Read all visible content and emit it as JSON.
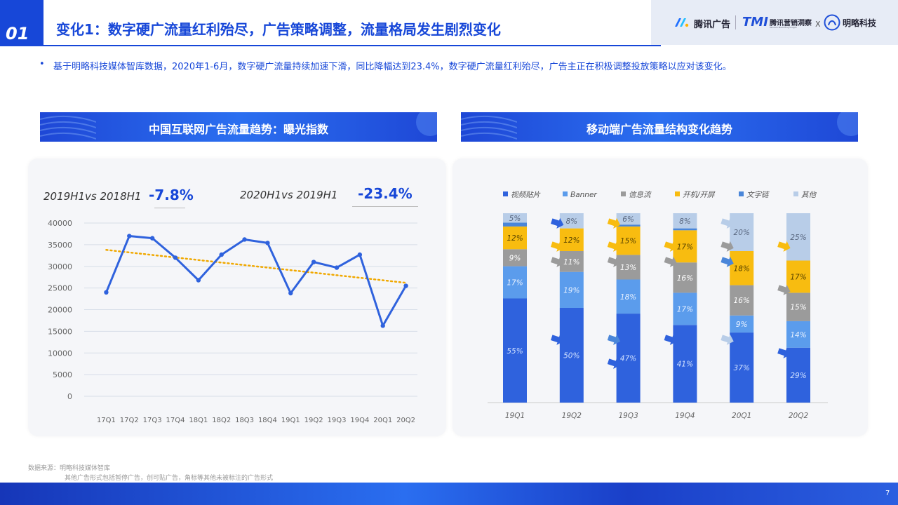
{
  "header": {
    "number": "01",
    "title": "变化1：数字硬广流量红利殆尽，广告策略调整，流量格局发生剧烈变化",
    "logos": {
      "tencent_ads": "腾讯广告",
      "tmi_mark": "TMI",
      "tmi_name": "腾讯营销洞察",
      "tmi_sub": "Tencent Marketing Insight",
      "x": "X",
      "minglue": "明略科技"
    }
  },
  "bullet": {
    "marker": "•",
    "text": "基于明略科技媒体智库数据，2020年1-6月，数字硬广流量持续加速下滑，同比降幅达到23.4%，数字硬广流量红利殆尽，广告主正在积极调整投放策略以应对该变化。"
  },
  "left_chart": {
    "banner": "中国互联网广告流量趋势：曝光指数",
    "comparisons": [
      {
        "label": "2019H1vs 2018H1",
        "value": "-7.8%"
      },
      {
        "label": "2020H1vs 2019H1",
        "value": "-23.4%"
      }
    ]
  },
  "right_chart": {
    "banner": "移动端广告流量结构变化趋势"
  },
  "chart_data": [
    {
      "type": "line",
      "title": "中国互联网广告流量趋势：曝光指数",
      "categories": [
        "17Q1",
        "17Q2",
        "17Q3",
        "17Q4",
        "18Q1",
        "18Q2",
        "18Q3",
        "18Q4",
        "19Q1",
        "19Q2",
        "19Q3",
        "19Q4",
        "20Q1",
        "20Q2"
      ],
      "series": [
        {
          "values": [
            24000,
            37000,
            36500,
            32000,
            26800,
            32700,
            36200,
            35400,
            23800,
            31000,
            29700,
            32700,
            16300,
            25500
          ],
          "color": "#2f62dd"
        }
      ],
      "trendline": {
        "start": 33800,
        "end": 26200,
        "color": "#f0a800",
        "style": "dotted"
      },
      "ylim": [
        0,
        40000
      ],
      "yticks": [
        "0",
        "5000",
        "10000",
        "15000",
        "20000",
        "25000",
        "30000",
        "35000",
        "40000"
      ],
      "grid": true,
      "xlabel": "",
      "ylabel": ""
    },
    {
      "type": "bar",
      "stacked": true,
      "normalized": true,
      "title": "移动端广告流量结构变化趋势",
      "legend_position": "top",
      "categories": [
        "19Q1",
        "19Q2",
        "19Q3",
        "19Q4",
        "20Q1",
        "20Q2"
      ],
      "series": [
        {
          "name": "视频贴片",
          "color": "#2f62dd",
          "values": [
            55,
            50,
            47,
            41,
            37,
            29
          ]
        },
        {
          "name": "Banner",
          "color": "#5b9cec",
          "values": [
            17,
            19,
            18,
            17,
            9,
            14
          ]
        },
        {
          "name": "信息流",
          "color": "#9b9b9b",
          "values": [
            9,
            11,
            13,
            16,
            16,
            15
          ]
        },
        {
          "name": "开机/开屏",
          "color": "#f8bc10",
          "values": [
            12,
            12,
            15,
            17,
            18,
            17
          ]
        },
        {
          "name": "文字链",
          "color": "#4a86d9",
          "values": [
            2,
            0,
            1,
            1,
            0,
            0
          ]
        },
        {
          "name": "其他",
          "color": "#b8cde8",
          "values": [
            5,
            8,
            6,
            8,
            20,
            25
          ]
        }
      ],
      "labels": [
        [
          "55%",
          "17%",
          "9%",
          "12%",
          "",
          "5%"
        ],
        [
          "50%",
          "19%",
          "11%",
          "12%",
          "",
          "8%"
        ],
        [
          "47%",
          "18%",
          "13%",
          "15%",
          "",
          "6%"
        ],
        [
          "41%",
          "17%",
          "16%",
          "17%",
          "",
          "8%"
        ],
        [
          "37%",
          "9%",
          "16%",
          "18%",
          "",
          "20%"
        ],
        [
          "29%",
          "14%",
          "15%",
          "17%",
          "",
          "25%"
        ]
      ],
      "label_colors": [
        "#cfe0ff",
        "#e8f1ff",
        "#ffffff",
        "#5a4500",
        "#ffffff",
        "#5a6880"
      ],
      "arrows": [
        [
          "#2f62dd",
          "#f8bc10",
          "#b8cde8"
        ],
        [
          "#f8bc10",
          "#f8bc10",
          "#9b9b9b"
        ],
        [
          "#9b9b9b",
          "#9b9b9b",
          "#4a86d9"
        ],
        [
          "#2f62dd",
          "#4a86d9",
          "#b8cde8"
        ]
      ]
    }
  ],
  "footer": {
    "source": "数据来源：明略科技媒体智库",
    "note": "其他广告形式包括暂停广告，创可贴广告，角标等其他未被标注的广告形式",
    "page": "7"
  }
}
